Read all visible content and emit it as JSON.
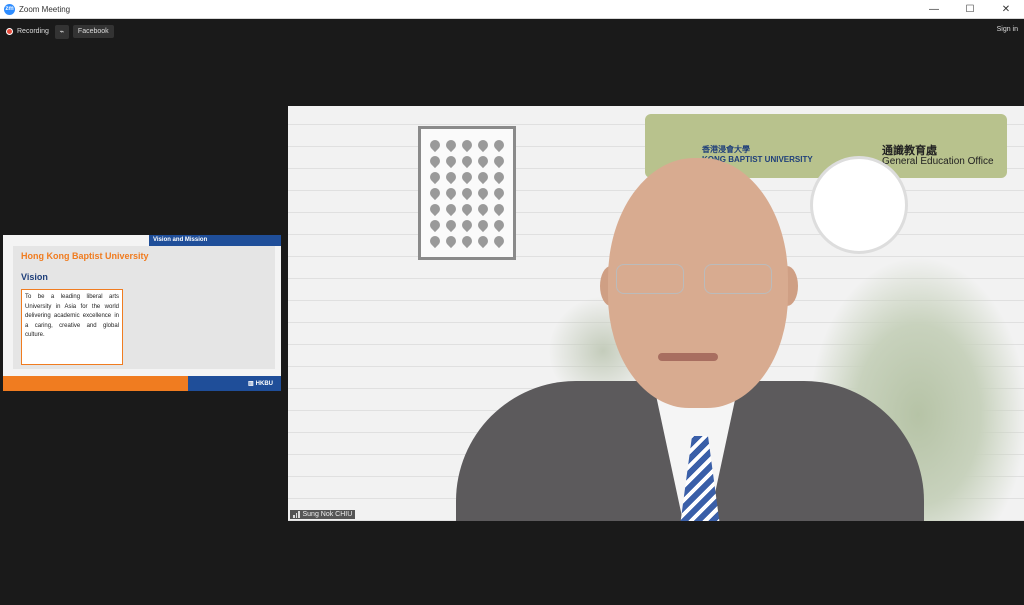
{
  "window": {
    "title": "Zoom Meeting",
    "app_icon_label": "zm"
  },
  "toolbar": {
    "recording_label": "Recording",
    "live_label": "Facebook",
    "signin_label": "Sign in"
  },
  "slide": {
    "tab": "Vision and Mission",
    "title": "Hong Kong Baptist University",
    "heading": "Vision",
    "body": "To be a leading liberal arts University in Asia for the world delivering academic excellence in a caring, creative and global culture.",
    "footer_logo": "HKBU"
  },
  "video": {
    "banner_zh": "香港浸會大學",
    "banner_en": "KONG BAPTIST UNIVERSITY",
    "office_zh": "通識教育處",
    "office_en": "General Education Office",
    "participant_name": "Sung Nok CHIU"
  },
  "colors": {
    "accent_orange": "#f07c20",
    "hkbu_blue": "#1f4e99",
    "recording_red": "#e74c3c"
  }
}
